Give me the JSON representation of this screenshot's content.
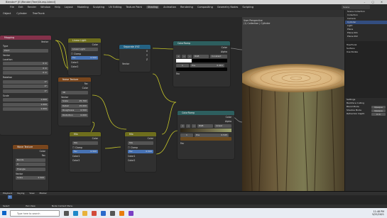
{
  "window": {
    "title": "Blender* [E:\\Render\\Tree\\Stump.blend]"
  },
  "menu": {
    "items": [
      "File",
      "Edit",
      "Render",
      "Window",
      "Help"
    ],
    "workspaces": [
      "Layout",
      "Modeling",
      "Sculpting",
      "UV Editing",
      "Texture Paint",
      "Shading",
      "Animation",
      "Rendering",
      "Compositing",
      "Geometry Nodes",
      "Scripting"
    ],
    "scene": "Scene"
  },
  "header": {
    "object": "Object",
    "cylinder": "Cylinder",
    "material": "TreeTrunk"
  },
  "nodes": {
    "mapping": {
      "title": "Mapping",
      "output": "Vector",
      "type_label": "Type",
      "type_value": "Point",
      "vector_label": "Vector",
      "location_label": "Location",
      "location": [
        "0 m",
        "0 m",
        "0 m"
      ],
      "rotation_label": "Rotation",
      "rotation": [
        "0°",
        "0°",
        "0°"
      ],
      "scale_label": "Scale",
      "scale": [
        "1.000",
        "1.000",
        "1.000"
      ]
    },
    "linear_light": {
      "title": "Linear Light",
      "output": "Color",
      "mode": "Linear Light",
      "clamp": "☐ Clamp",
      "fac_label": "Fac",
      "fac_value": "0.500",
      "color1": "Color1",
      "color2": "Color2"
    },
    "separate_xyz": {
      "title": "Separate XYZ",
      "outputs": [
        "X",
        "Y",
        "Z"
      ],
      "input": "Vector"
    },
    "noise": {
      "title": "Noise Texture",
      "outputs": [
        "Fac",
        "Color"
      ],
      "dimension": "3D",
      "vector": "Vector",
      "fields": [
        {
          "label": "Scale",
          "value": "25.700"
        },
        {
          "label": "Detail",
          "value": "15.000"
        },
        {
          "label": "Roughness",
          "value": "0.500"
        },
        {
          "label": "Distortion",
          "value": "0.000"
        }
      ]
    },
    "colorramp1": {
      "title": "ColorRamp",
      "outputs": [
        "Color",
        "Alpha"
      ],
      "mode": "RGB",
      "interp": "Constant",
      "index": "1",
      "pos_label": "Pos",
      "pos_value": "0.461",
      "input": "Fac"
    },
    "colorramp2": {
      "title": "ColorRamp",
      "outputs": [
        "Color",
        "Alpha"
      ],
      "mode": "RGB",
      "interp": "Linear",
      "index": "1",
      "pos_label": "Pos",
      "pos_value": "0.545",
      "input": "Fac"
    },
    "mix1": {
      "title": "Mix",
      "output": "Color",
      "mode": "Mix",
      "clamp": "☐ Clamp",
      "fac_label": "Fac",
      "fac_value": "0.500",
      "color1": "Color1",
      "color2": "Color2"
    },
    "mix2": {
      "title": "Mix",
      "output": "Color",
      "mode": "Mix",
      "clamp": "☐ Clamp",
      "fac_label": "Fac",
      "fac_value": "0.500",
      "color1": "Color1",
      "color2": "Color2"
    },
    "wave": {
      "title": "Wave Texture",
      "outputs": [
        "Color",
        "Fac"
      ],
      "type": "Bands",
      "direction": "X",
      "profile": "Triangle",
      "vector": "Vector",
      "scale_label": "Scale",
      "scale_value": "2.500"
    }
  },
  "viewport": {
    "perspective": "User Perspective",
    "collection": "(1) Collection | Cylinder"
  },
  "outliner": {
    "title": "Scene Collection",
    "items": [
      "Collection",
      "Camera",
      "Cylinder",
      "Light",
      "Plane",
      "Plane.001",
      "Plane.002"
    ]
  },
  "properties": {
    "material": "TreeTrunk",
    "surface_label": "Surface",
    "surface_value": "Use Nodes",
    "settings_label": "Settings",
    "backface": "Backface Culling",
    "blend_label": "Blend Mode",
    "blend_value": "Opaque",
    "shadow_label": "Shadow Mode",
    "shadow_value": "Opaque",
    "refr_label": "Refraction Depth",
    "refr_value": "0 m"
  },
  "timeline": {
    "playback": "Playback",
    "keying": "Keying",
    "view": "View",
    "marker": "Marker",
    "current": "1"
  },
  "status": {
    "select": "Select",
    "pan": "Pan View",
    "menu": "Node Context Menu"
  },
  "taskbar": {
    "search": "Type here to search",
    "time": "11:48 PM",
    "date": "5/25/2021"
  }
}
